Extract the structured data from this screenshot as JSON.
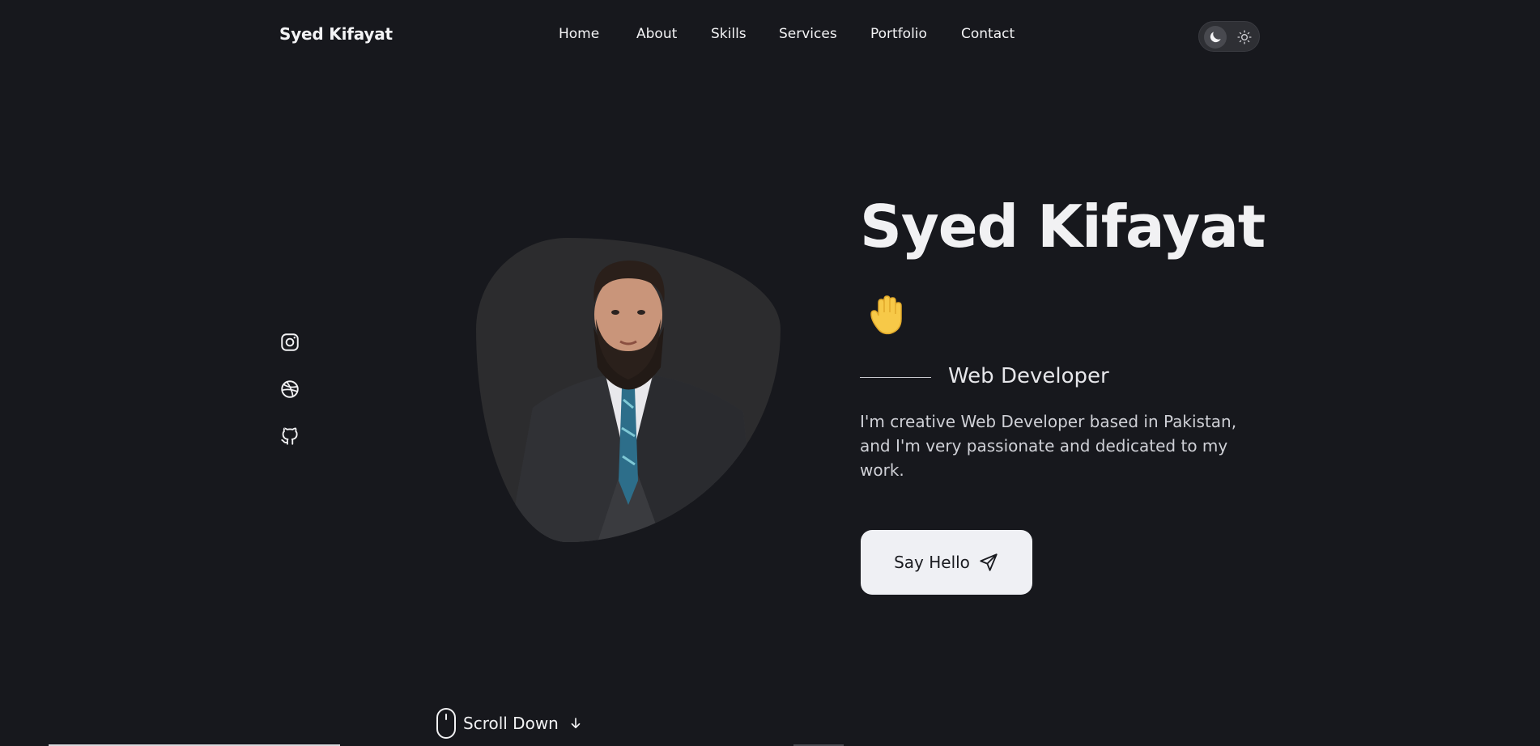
{
  "header": {
    "brand": "Syed Kifayat",
    "nav": [
      "Home",
      "About",
      "Skills",
      "Services",
      "Portfolio",
      "Contact"
    ],
    "theme_toggle_icons": [
      "moon-icon",
      "sun-icon"
    ]
  },
  "social": {
    "icons": [
      "instagram-icon",
      "dribbble-icon",
      "github-icon"
    ]
  },
  "hero": {
    "title": "Syed Kifayat",
    "wave_emoji": "🖐",
    "subtitle": "Web Developer",
    "description": "I'm creative Web Developer based in Pakistan, and I'm very passionate and dedicated to my work.",
    "cta_label": "Say Hello"
  },
  "scroll": {
    "label": "Scroll Down"
  },
  "colors": {
    "background": "#17181d",
    "text": "#f1f1f3",
    "button_bg": "#eff0f4",
    "blob": "#2c2c2e"
  }
}
